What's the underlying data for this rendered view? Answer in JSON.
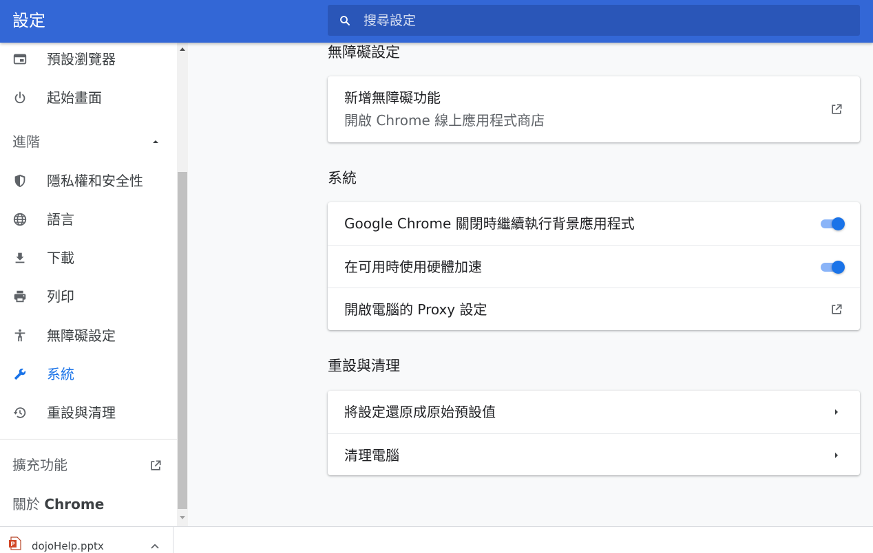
{
  "header": {
    "title": "設定",
    "search_placeholder": "搜尋設定"
  },
  "sidebar": {
    "items_top": [
      {
        "label": "預設瀏覽器",
        "icon": "browser-window-icon"
      },
      {
        "label": "起始畫面",
        "icon": "power-icon"
      }
    ],
    "advanced_label": "進階",
    "items_advanced": [
      {
        "label": "隱私權和安全性",
        "icon": "shield-icon"
      },
      {
        "label": "語言",
        "icon": "globe-icon"
      },
      {
        "label": "下載",
        "icon": "download-icon"
      },
      {
        "label": "列印",
        "icon": "printer-icon"
      },
      {
        "label": "無障礙設定",
        "icon": "accessibility-icon"
      },
      {
        "label": "系統",
        "icon": "wrench-icon",
        "active": true
      },
      {
        "label": "重設與清理",
        "icon": "history-icon"
      }
    ],
    "extensions_label": "擴充功能",
    "about_prefix": "關於 ",
    "about_brand": "Chrome"
  },
  "main": {
    "accessibility": {
      "title": "無障礙設定",
      "row_title": "新增無障礙功能",
      "row_subtitle": "開啟 Chrome 線上應用程式商店"
    },
    "system": {
      "title": "系統",
      "rows": [
        {
          "label": "Google Chrome 關閉時繼續執行背景應用程式",
          "enabled": true
        },
        {
          "label": "在可用時使用硬體加速",
          "enabled": true
        },
        {
          "label": "開啟電腦的 Proxy 設定"
        }
      ]
    },
    "reset": {
      "title": "重設與清理",
      "rows": [
        {
          "label": "將設定還原成原始預設值"
        },
        {
          "label": "清理電腦"
        }
      ]
    }
  },
  "download_bar": {
    "filename": "dojoHelp.pptx"
  },
  "colors": {
    "header": "#3367d6",
    "accent": "#1a73e8",
    "toggle_track": "#8ab4f8"
  }
}
